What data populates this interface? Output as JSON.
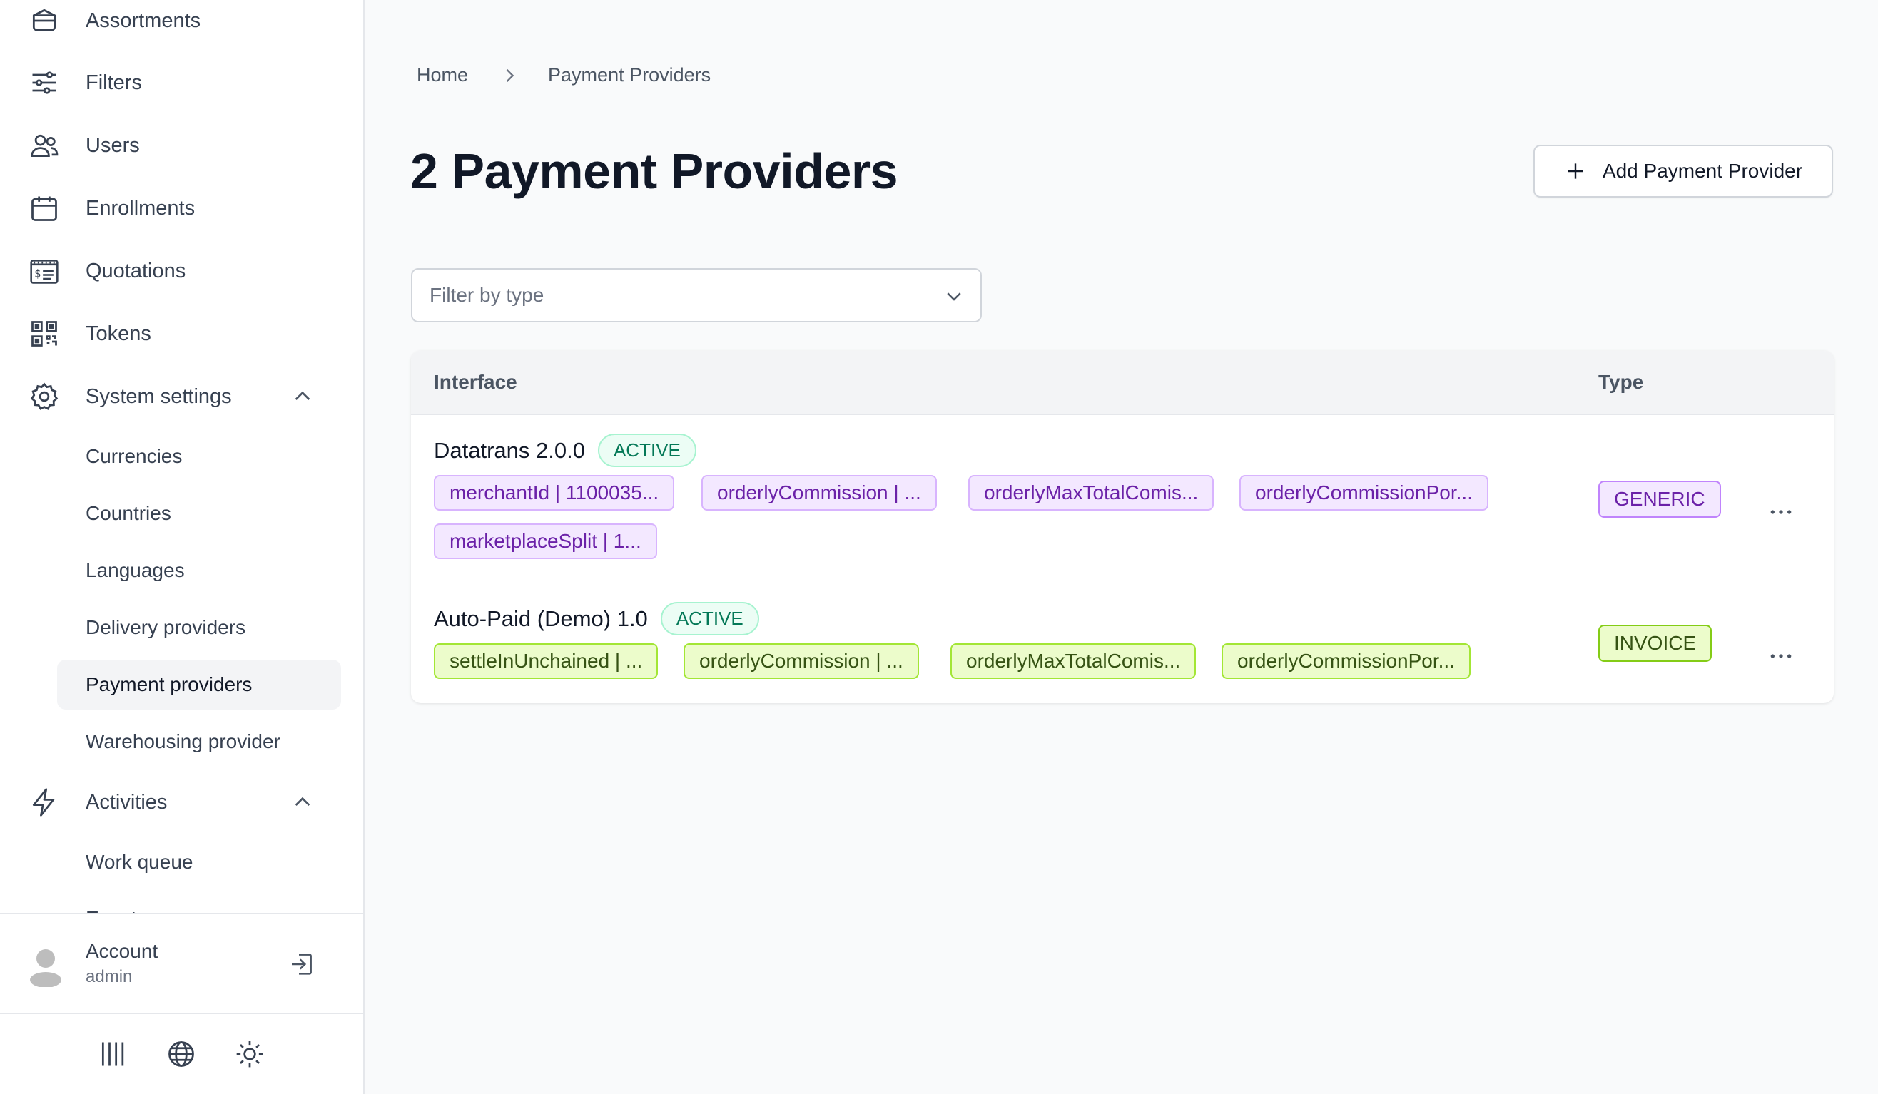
{
  "sidebar": {
    "items": [
      {
        "label": "Assortments",
        "icon": "cube-icon"
      },
      {
        "label": "Filters",
        "icon": "sliders-icon"
      },
      {
        "label": "Users",
        "icon": "users-icon"
      },
      {
        "label": "Enrollments",
        "icon": "calendar-icon"
      },
      {
        "label": "Quotations",
        "icon": "receipt-icon"
      },
      {
        "label": "Tokens",
        "icon": "qr-code-icon"
      },
      {
        "label": "System settings",
        "icon": "gear-icon",
        "expanded": true
      },
      {
        "label": "Activities",
        "icon": "bolt-icon",
        "expanded": true
      }
    ],
    "system_settings": [
      "Currencies",
      "Countries",
      "Languages",
      "Delivery providers",
      "Payment providers",
      "Warehousing provider"
    ],
    "active_sub": "Payment providers",
    "activities": [
      "Work queue",
      "Events"
    ],
    "account": {
      "name": "Account",
      "role": "admin"
    },
    "footer_icons": [
      "barcode-icon",
      "globe-icon",
      "sun-icon"
    ]
  },
  "breadcrumb": {
    "home": "Home",
    "current": "Payment Providers"
  },
  "page": {
    "title": "2 Payment Providers",
    "add_button": "Add Payment Provider",
    "filter_placeholder": "Filter by type"
  },
  "table": {
    "columns": {
      "interface": "Interface",
      "type": "Type"
    },
    "rows": [
      {
        "name": "Datatrans 2.0.0",
        "status": "ACTIVE",
        "type": "GENERIC",
        "type_color": "#f3e8ff",
        "config": [
          "merchantId | 1100035...",
          "orderlyCommission | ...",
          "orderlyMaxTotalComis...",
          "orderlyCommissionPor...",
          "marketplaceSplit | 1..."
        ]
      },
      {
        "name": "Auto-Paid (Demo) 1.0",
        "status": "ACTIVE",
        "type": "INVOICE",
        "type_color": "#ecfccb",
        "config": [
          "settleInUnchained | ...",
          "orderlyCommission | ...",
          "orderlyMaxTotalComis...",
          "orderlyCommissionPor..."
        ]
      }
    ]
  },
  "colors": {
    "active_green": "#047857",
    "purple_chip": "#6b21a8",
    "lime_chip": "#365314"
  }
}
